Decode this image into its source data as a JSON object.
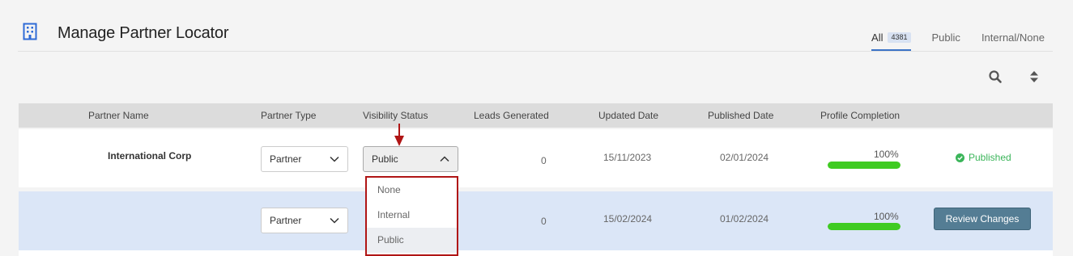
{
  "header": {
    "title": "Manage Partner Locator",
    "tabs": [
      {
        "label": "All",
        "count": "4381",
        "active": true
      },
      {
        "label": "Public"
      },
      {
        "label": "Internal/None"
      }
    ]
  },
  "toolbar": {
    "icons": [
      "search-icon",
      "sort-icon"
    ]
  },
  "table": {
    "headers": [
      "Partner Name",
      "Partner Type",
      "Visibility Status",
      "Leads Generated",
      "Updated Date",
      "Published Date",
      "Profile Completion"
    ],
    "rows": [
      {
        "partner_name": "International Corp",
        "partner_type": "Partner",
        "visibility": "Public",
        "leads": "0",
        "updated": "15/11/2023",
        "published": "02/01/2024",
        "completion_label": "100%",
        "completion": 1.0,
        "status": "Published"
      },
      {
        "partner_name": "",
        "partner_type": "Partner",
        "visibility": "",
        "leads": "0",
        "updated": "15/02/2024",
        "published": "01/02/2024",
        "completion_label": "100%",
        "completion": 1.0,
        "action": "Review Changes"
      }
    ]
  },
  "visibility_dropdown": {
    "options": [
      "None",
      "Internal",
      "Public"
    ],
    "selected": "Public"
  },
  "colors": {
    "accent": "#3b73c6",
    "progress": "#3fcb22",
    "published": "#3bb55a",
    "review_button": "#547d94",
    "highlight_border": "#b01515",
    "selected_row": "#dbe6f7"
  }
}
